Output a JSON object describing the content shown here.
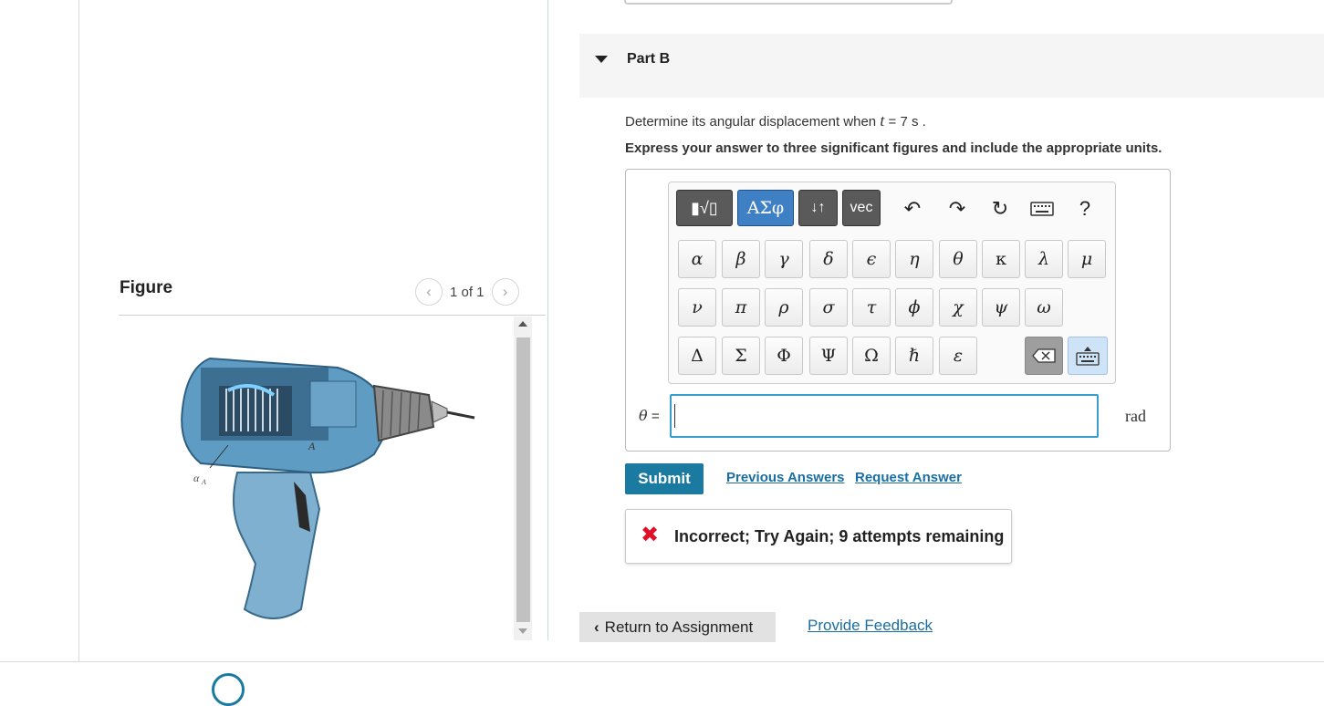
{
  "figure_panel": {
    "title": "Figure",
    "page_indicator": "1 of 1",
    "prev_icon": "chevron-left-icon",
    "next_icon": "chevron-right-icon",
    "image_label": "α",
    "image_label_subscript": "A",
    "image_point_label": "A"
  },
  "part": {
    "label": "Part B",
    "question_prefix": "Determine its angular displacement when",
    "question_var": "t",
    "question_suffix": "= 7  s .",
    "instruction": "Express your answer to three significant figures and include the appropriate units."
  },
  "toolbar": {
    "template_label": "▮√▯",
    "greek_label": "ΑΣφ",
    "arrows_label": "↓↑",
    "vec_label": "vec",
    "help_label": "?"
  },
  "greek_keys": {
    "row1": [
      "α",
      "β",
      "γ",
      "δ",
      "ϵ",
      "η",
      "θ",
      "κ",
      "λ",
      "μ"
    ],
    "row2": [
      "ν",
      "π",
      "ρ",
      "σ",
      "τ",
      "ϕ",
      "χ",
      "ψ",
      "ω"
    ],
    "row3": [
      "Δ",
      "Σ",
      "Φ",
      "Ψ",
      "Ω",
      "ℏ",
      "ε"
    ]
  },
  "answer": {
    "variable": "θ",
    "equals": "=",
    "value": "",
    "units": "rad"
  },
  "actions": {
    "submit": "Submit",
    "previous_answers": "Previous Answers",
    "request_answer": "Request Answer"
  },
  "feedback": {
    "text": "Incorrect; Try Again; 9 attempts remaining",
    "icon": "x-icon",
    "color": "#e0102a"
  },
  "footer": {
    "return": "Return to Assignment",
    "provide_feedback": "Provide Feedback"
  },
  "colors": {
    "accent": "#1a7aa0",
    "link": "#1a6fa0",
    "input_focus": "#3a9dcf"
  }
}
